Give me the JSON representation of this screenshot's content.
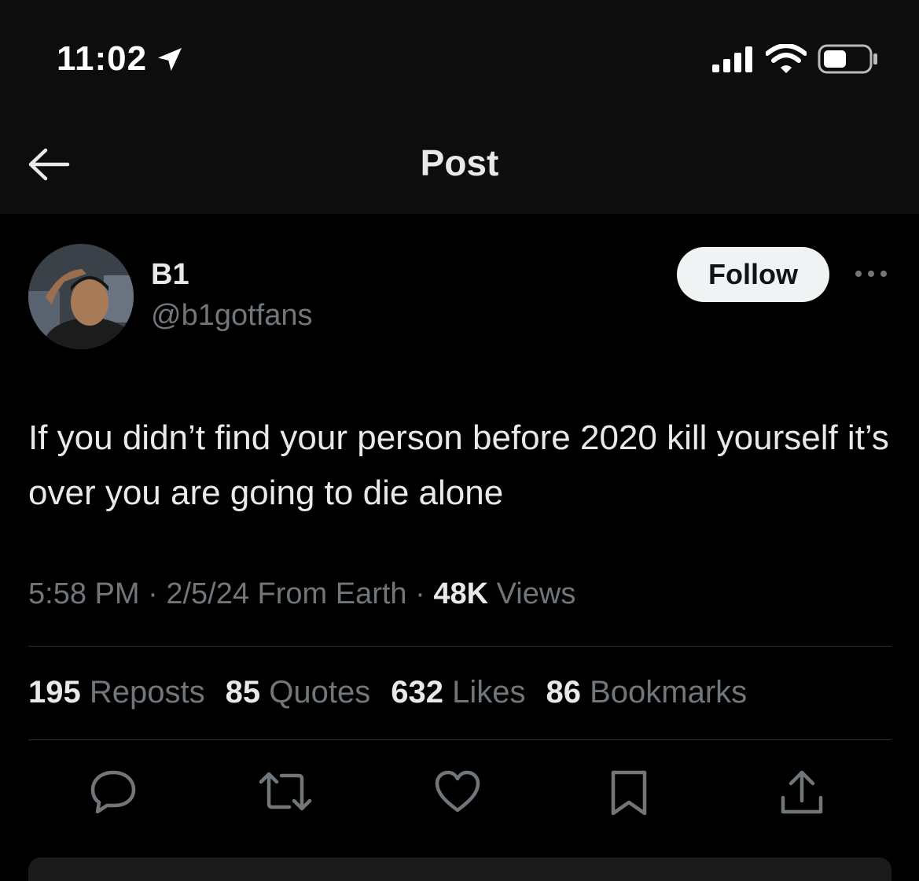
{
  "status_bar": {
    "time": "11:02",
    "icons": [
      "location-arrow-icon",
      "cellular-signal-icon",
      "wifi-icon",
      "battery-icon"
    ]
  },
  "header": {
    "title": "Post",
    "back_icon": "back-arrow-icon"
  },
  "post": {
    "author": {
      "display_name": "B1",
      "handle": "@b1gotfans"
    },
    "follow_label": "Follow",
    "text": "If you didn’t find your person before 2020 kill yourself it’s over you are going to die alone",
    "meta": {
      "time": "5:58 PM",
      "date": "2/5/24",
      "source": "From Earth",
      "views_count": "48K",
      "views_label": "Views",
      "separator": "·"
    },
    "stats": [
      {
        "count": "195",
        "label": "Reposts"
      },
      {
        "count": "85",
        "label": "Quotes"
      },
      {
        "count": "632",
        "label": "Likes"
      },
      {
        "count": "86",
        "label": "Bookmarks"
      }
    ],
    "actions": [
      "reply-icon",
      "repost-icon",
      "like-icon",
      "bookmark-icon",
      "share-icon"
    ]
  },
  "colors": {
    "background": "#000000",
    "header_background": "#0d0d0d",
    "primary_text": "#e7e9ea",
    "secondary_text": "#71767b",
    "divider": "#2f3336",
    "follow_button_bg": "#eff3f4"
  }
}
